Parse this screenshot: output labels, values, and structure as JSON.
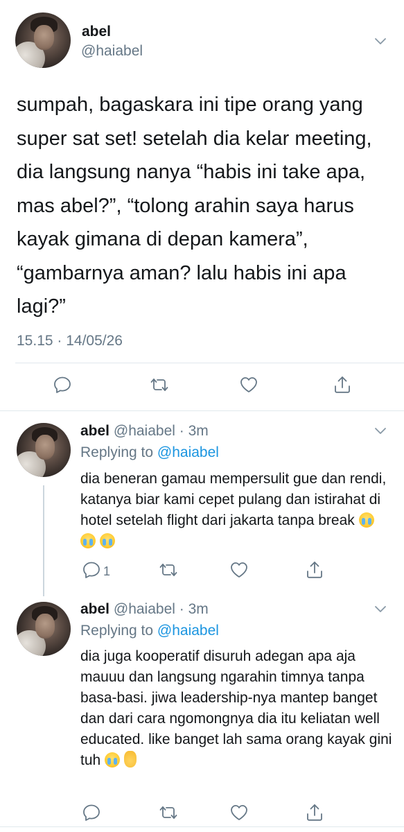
{
  "main_tweet": {
    "name": "abel",
    "handle": "@haiabel",
    "text": "sumpah, bagaskara ini tipe orang yang super sat set! setelah dia kelar meeting, dia langsung nanya “habis ini take apa, mas abel?”, “tolong arahin saya harus kayak gimana di depan kamera”, “gambarnya aman? lalu habis ini apa lagi?”",
    "timestamp": "15.15 · 14/05/26",
    "actions": [
      "reply-icon",
      "retweet-icon",
      "like-icon",
      "share-icon"
    ]
  },
  "replies": [
    {
      "name": "abel",
      "handle": "@haiabel · 3m",
      "replying_prefix": "Replying to ",
      "replying_to": "@haiabel",
      "text": "dia beneran gamau mempersulit gue dan rendi, katanya biar kami cepet pulang dan istirahat di hotel setelah flight dari jakarta tanpa break",
      "emoji": [
        "loudly-crying-face",
        "loudly-crying-face",
        "loudly-crying-face"
      ],
      "reply_count": "1"
    },
    {
      "name": "abel",
      "handle": "@haiabel · 3m",
      "replying_prefix": "Replying to ",
      "replying_to": "@haiabel",
      "text": "dia juga kooperatif disuruh adegan apa aja mauuu dan langsung ngarahin timnya tanpa basa-basi. jiwa leadership-nya mantep banget dan dari cara ngomongnya dia itu keliatan well educated. like banget lah sama orang kayak gini tuh",
      "emoji": [
        "loudly-crying-face",
        "pinched-fingers-hand"
      ],
      "reply_count": ""
    }
  ],
  "colors": {
    "text": "#14171a",
    "secondary": "#657786",
    "link": "#1b95e0",
    "divider": "#e1e8ed"
  }
}
